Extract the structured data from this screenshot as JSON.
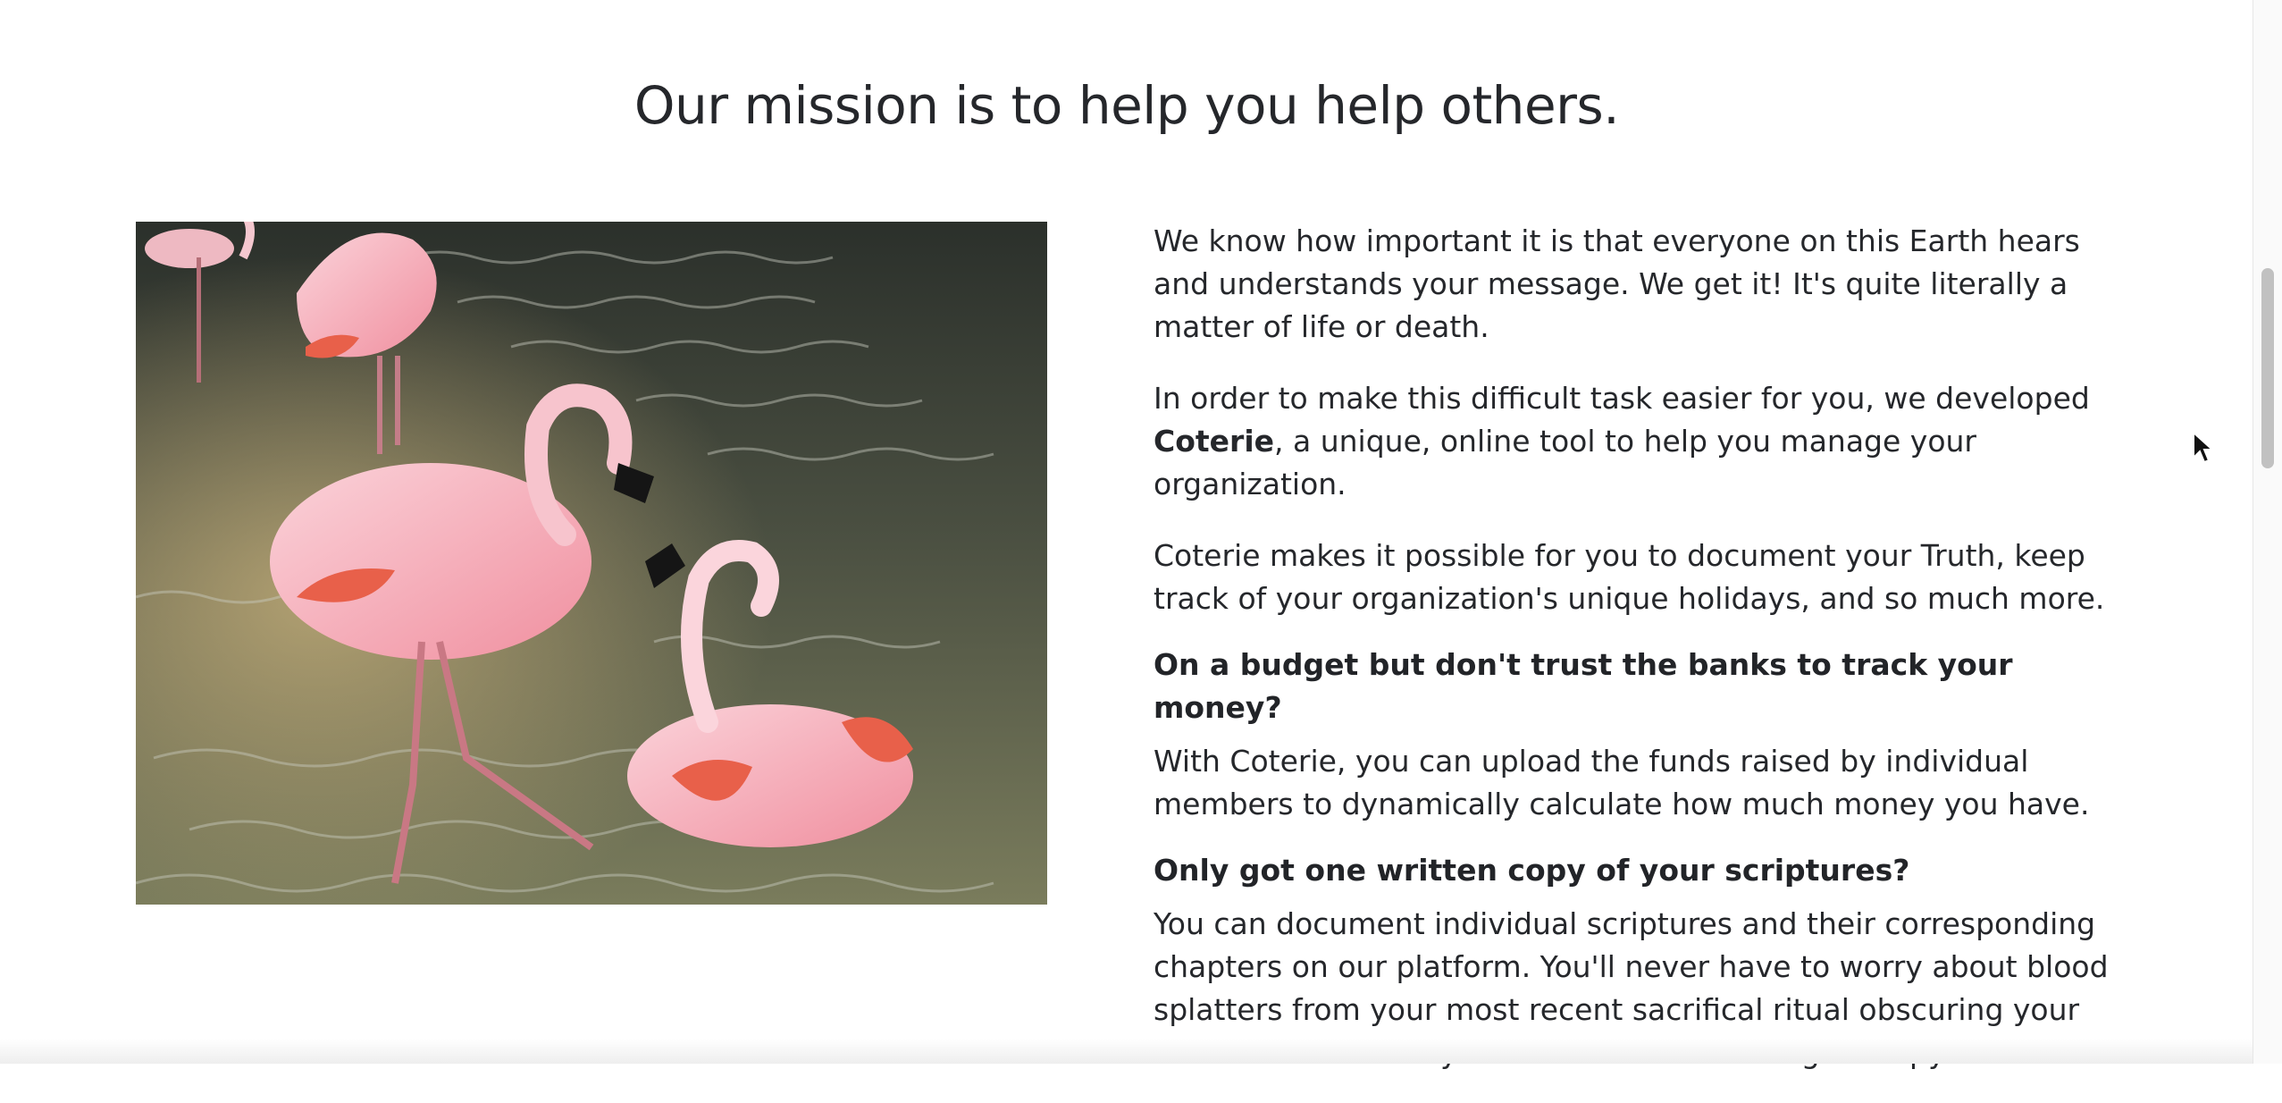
{
  "mission": {
    "title": "Our mission is to help you help others.",
    "photo_alt": "Flamingos wading in water",
    "paragraphs": {
      "p1": "We know how important it is that everyone on this Earth hears and understands your message. We get it! It's quite literally a matter of life or death.",
      "p2_before": "In order to make this difficult task easier for you, we developed ",
      "p2_brand": "Coterie",
      "p2_after": ", a unique, online tool to help you manage your organization.",
      "p3": "Coterie makes it possible for you to document your Truth, keep track of your organization's unique holidays, and so much more."
    },
    "features": [
      {
        "heading": "On a budget but don't trust the banks to track your money?",
        "body": "With Coterie, you can upload the funds raised by individual members to dynamically calculate how much money you have."
      },
      {
        "heading": "Only got one written copy of your scriptures?",
        "body": "You can document individual scriptures and their corresponding chapters on our platform. You'll never have to worry about blood splatters from your most recent sacrifical ritual obscuring your written Truth when you can reference the digital copy!"
      }
    ]
  },
  "colors": {
    "text": "#25272b",
    "background": "#ffffff",
    "flamingo_pink": "#f4a9b8",
    "flamingo_orange": "#e8604a",
    "water": "#4a5240"
  },
  "icons": [
    "cursor-arrow-icon"
  ]
}
